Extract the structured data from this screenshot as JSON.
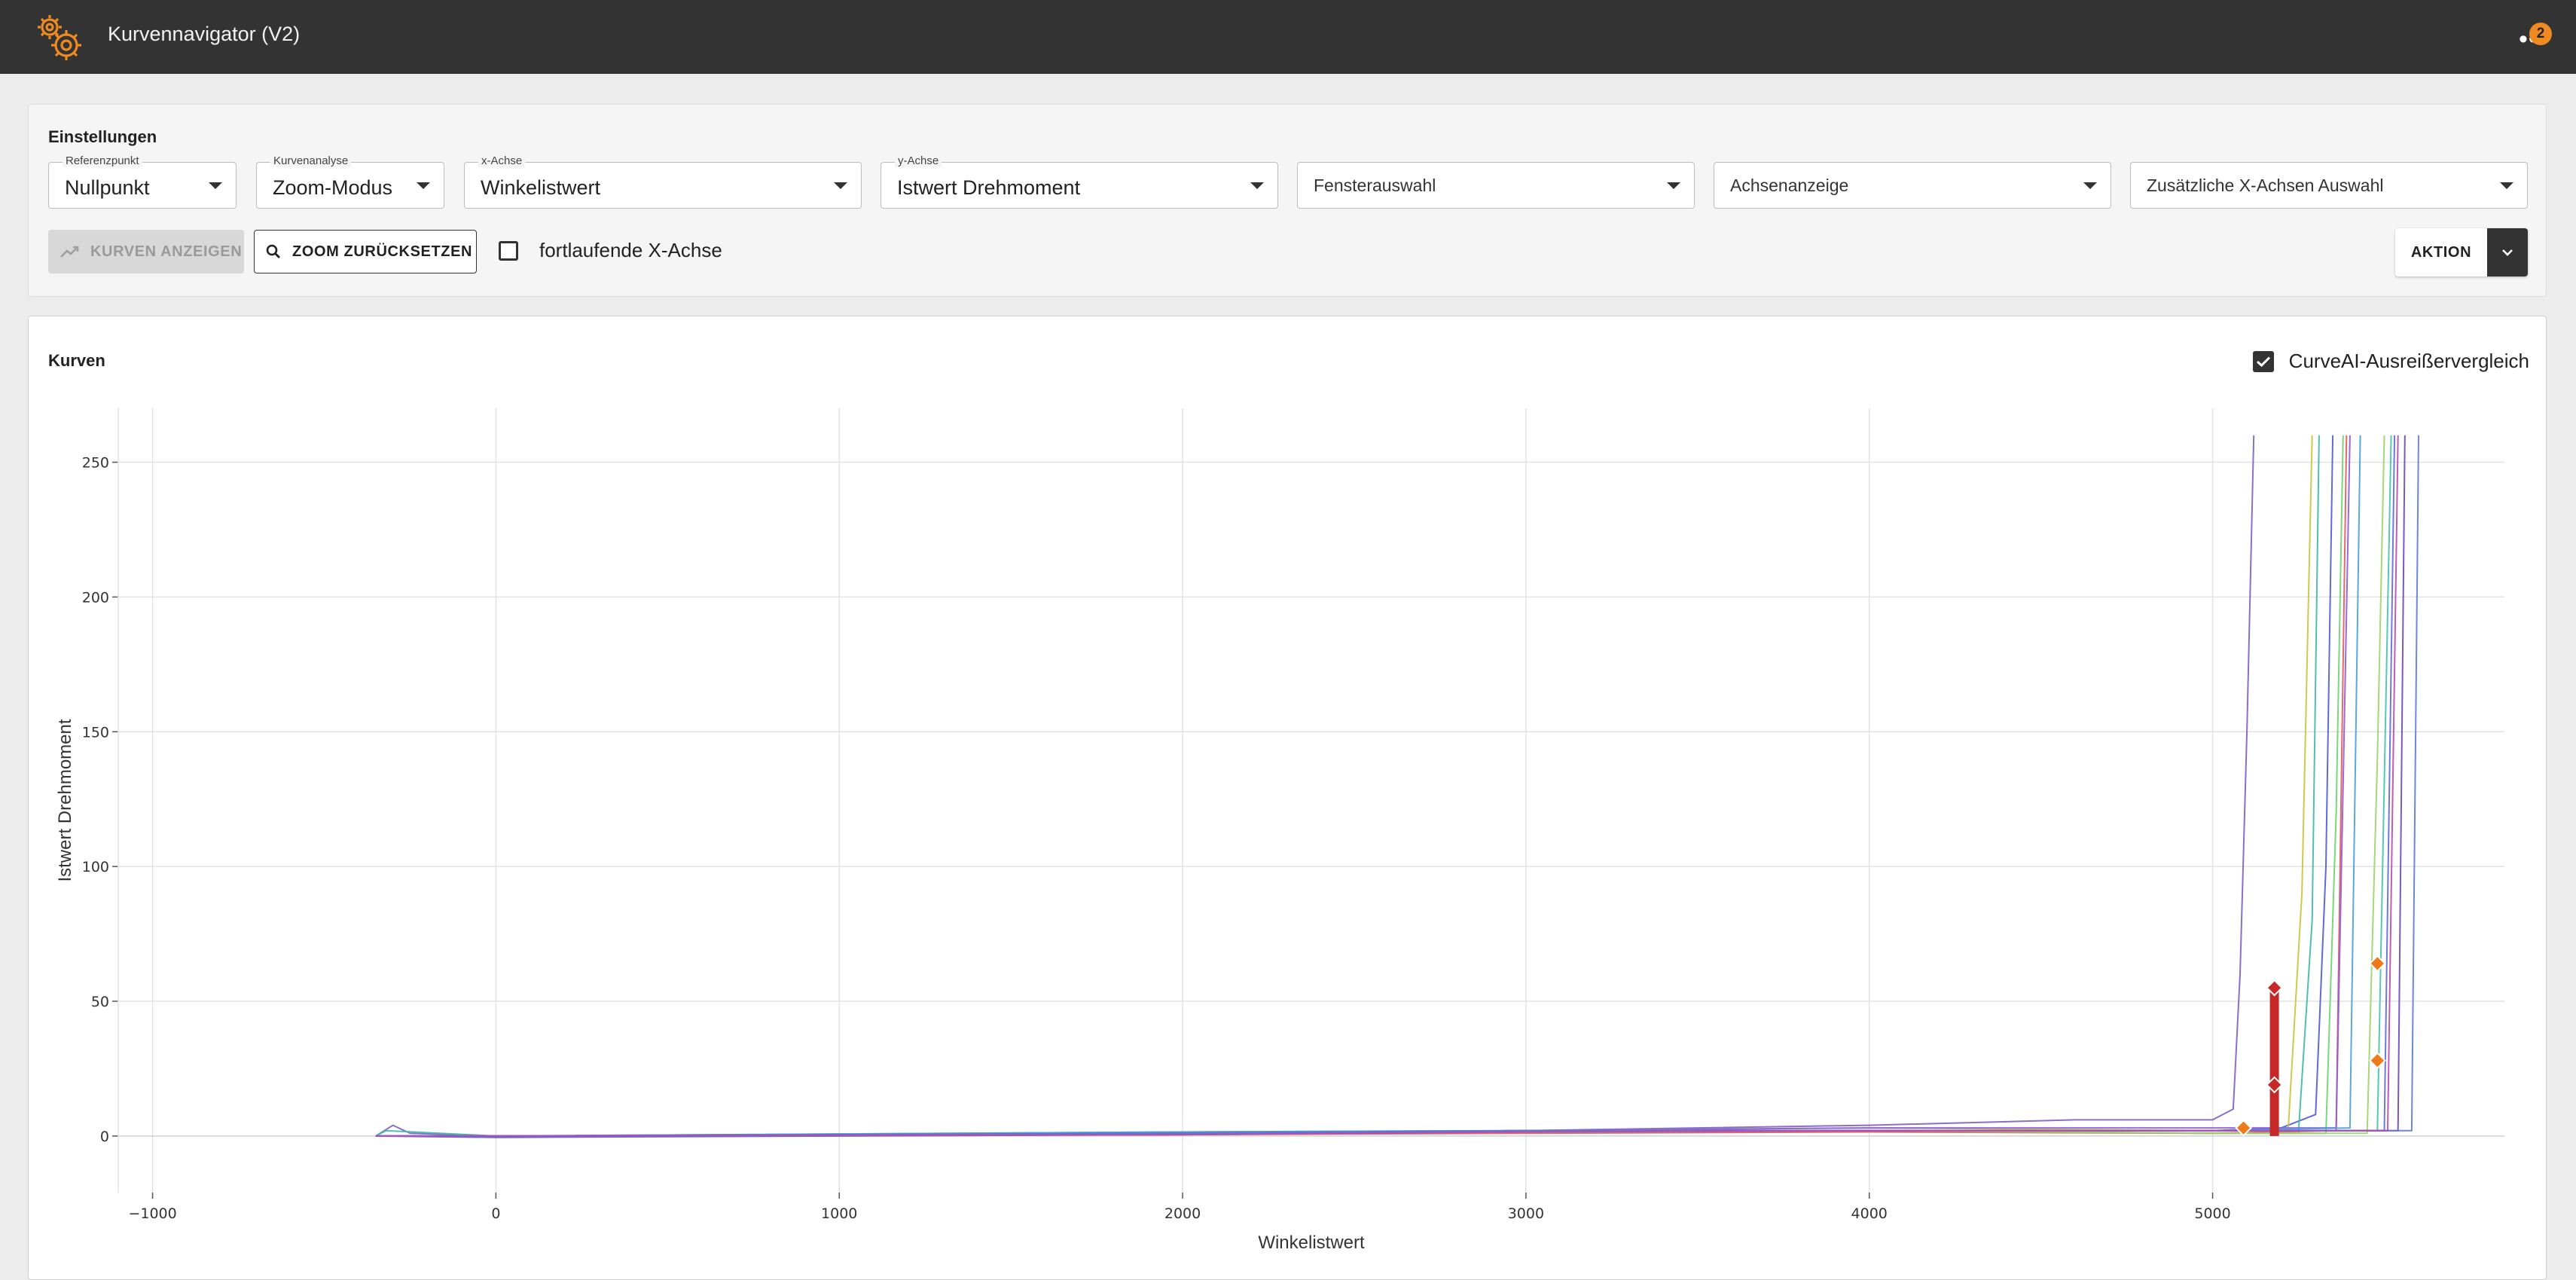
{
  "app": {
    "title": "Kurvennavigator (V2)",
    "notification_count": "2",
    "more_icon": "more-horizontal-icon",
    "logo_icon": "gears-icon",
    "accent": "#ef8a23"
  },
  "settings": {
    "title": "Einstellungen",
    "selects": [
      {
        "label": "Referenzpunkt",
        "value": "Nullpunkt"
      },
      {
        "label": "Kurvenanalyse",
        "value": "Zoom-Modus"
      },
      {
        "label": "x-Achse",
        "value": "Winkelistwert"
      },
      {
        "label": "y-Achse",
        "value": "Istwert Drehmoment"
      },
      {
        "label": "",
        "placeholder": "Fensterauswahl"
      },
      {
        "label": "",
        "placeholder": "Achsenanzeige"
      },
      {
        "label": "",
        "placeholder": "Zusätzliche X-Achsen Auswahl"
      }
    ],
    "show_curves_label": "KURVEN ANZEIGEN",
    "reset_zoom_label": "ZOOM ZURÜCKSETZEN",
    "continuous_x_label": "fortlaufende X-Achse",
    "continuous_x_checked": false,
    "action_label": "AKTION"
  },
  "curves": {
    "title": "Kurven",
    "ai_compare_label": "CurveAI-Ausreißervergleich",
    "ai_compare_checked": true
  },
  "chart_data": {
    "type": "line",
    "xlabel": "Winkelistwert",
    "ylabel": "Istwert Drehmoment",
    "xlim": [
      -1100,
      5850
    ],
    "ylim": [
      -21,
      270
    ],
    "xticks": [
      -1000,
      0,
      1000,
      2000,
      3000,
      4000,
      5000
    ],
    "xtick_labels": [
      "−1000",
      "0",
      "1000",
      "2000",
      "3000",
      "4000",
      "5000"
    ],
    "yticks": [
      0,
      50,
      100,
      150,
      200,
      250
    ],
    "grid": true,
    "series": [
      {
        "color": "#7b61c4",
        "values": [
          [
            -350,
            0
          ],
          [
            -300,
            4
          ],
          [
            -250,
            1
          ],
          [
            0,
            0
          ],
          [
            2000,
            1
          ],
          [
            3000,
            2
          ],
          [
            4000,
            4
          ],
          [
            4600,
            6
          ],
          [
            5000,
            6
          ],
          [
            5060,
            10
          ],
          [
            5080,
            60
          ],
          [
            5100,
            150
          ],
          [
            5120,
            260
          ]
        ]
      },
      {
        "color": "#4e5bd6",
        "values": [
          [
            -350,
            0
          ],
          [
            0,
            -0.5
          ],
          [
            2000,
            0.5
          ],
          [
            3000,
            1.5
          ],
          [
            4000,
            2
          ],
          [
            5000,
            2
          ],
          [
            5200,
            3
          ],
          [
            5300,
            8
          ],
          [
            5330,
            100
          ],
          [
            5350,
            260
          ]
        ]
      },
      {
        "color": "#3fb6a8",
        "values": [
          [
            -350,
            0
          ],
          [
            -320,
            2
          ],
          [
            0,
            0
          ],
          [
            2000,
            1.5
          ],
          [
            3000,
            2
          ],
          [
            4000,
            2
          ],
          [
            5000,
            1
          ],
          [
            5250,
            1
          ],
          [
            5290,
            80
          ],
          [
            5310,
            260
          ]
        ]
      },
      {
        "color": "#c9c43c",
        "values": [
          [
            -350,
            0
          ],
          [
            0,
            0
          ],
          [
            2000,
            1
          ],
          [
            3000,
            2
          ],
          [
            4000,
            3
          ],
          [
            5000,
            2
          ],
          [
            5220,
            2
          ],
          [
            5260,
            90
          ],
          [
            5290,
            260
          ]
        ]
      },
      {
        "color": "#6ad46a",
        "values": [
          [
            -350,
            0
          ],
          [
            0,
            0
          ],
          [
            2000,
            1
          ],
          [
            3000,
            2
          ],
          [
            4000,
            2
          ],
          [
            5000,
            1
          ],
          [
            5330,
            1
          ],
          [
            5360,
            120
          ],
          [
            5380,
            260
          ]
        ]
      },
      {
        "color": "#e05a5a",
        "values": [
          [
            -350,
            0
          ],
          [
            0,
            0
          ],
          [
            2000,
            0.5
          ],
          [
            3000,
            1
          ],
          [
            4000,
            1.5
          ],
          [
            5000,
            1
          ],
          [
            5360,
            2
          ],
          [
            5390,
            260
          ]
        ]
      },
      {
        "color": "#8d5bd8",
        "values": [
          [
            -350,
            0
          ],
          [
            0,
            0
          ],
          [
            2000,
            1
          ],
          [
            3000,
            2
          ],
          [
            4000,
            3
          ],
          [
            5000,
            3
          ],
          [
            5360,
            3
          ],
          [
            5380,
            130
          ],
          [
            5400,
            260
          ]
        ]
      },
      {
        "color": "#47a0d8",
        "values": [
          [
            -350,
            0
          ],
          [
            0,
            0
          ],
          [
            2000,
            1.5
          ],
          [
            3000,
            2
          ],
          [
            4000,
            2
          ],
          [
            5000,
            2
          ],
          [
            5400,
            3
          ],
          [
            5430,
            260
          ]
        ]
      },
      {
        "color": "#9ad46a",
        "values": [
          [
            -350,
            0
          ],
          [
            0,
            0
          ],
          [
            2000,
            1
          ],
          [
            3000,
            2
          ],
          [
            4000,
            2
          ],
          [
            5000,
            1
          ],
          [
            5450,
            1
          ],
          [
            5480,
            140
          ],
          [
            5500,
            260
          ]
        ]
      },
      {
        "color": "#45c2a8",
        "values": [
          [
            -350,
            0
          ],
          [
            0,
            0
          ],
          [
            2000,
            1
          ],
          [
            3000,
            1.5
          ],
          [
            4000,
            2
          ],
          [
            5000,
            2
          ],
          [
            5480,
            2
          ],
          [
            5520,
            260
          ]
        ]
      },
      {
        "color": "#5e6ad8",
        "values": [
          [
            -350,
            0
          ],
          [
            0,
            0
          ],
          [
            2000,
            1
          ],
          [
            3000,
            2
          ],
          [
            4000,
            2
          ],
          [
            5000,
            2
          ],
          [
            5500,
            2
          ],
          [
            5530,
            260
          ]
        ]
      },
      {
        "color": "#6b46b8",
        "values": [
          [
            -350,
            0
          ],
          [
            0,
            0
          ],
          [
            2000,
            1
          ],
          [
            3000,
            2
          ],
          [
            4000,
            2
          ],
          [
            5000,
            2
          ],
          [
            5540,
            2
          ],
          [
            5560,
            260
          ]
        ]
      },
      {
        "color": "#5e7ad8",
        "values": [
          [
            -350,
            0
          ],
          [
            0,
            0
          ],
          [
            2000,
            1
          ],
          [
            3000,
            2
          ],
          [
            4000,
            2
          ],
          [
            5000,
            2
          ],
          [
            5580,
            2
          ],
          [
            5600,
            260
          ]
        ]
      },
      {
        "color": "#b84ab0",
        "values": [
          [
            -350,
            0
          ],
          [
            0,
            0
          ],
          [
            2000,
            0.5
          ],
          [
            3000,
            1.5
          ],
          [
            4000,
            2
          ],
          [
            5000,
            2
          ],
          [
            5510,
            2
          ],
          [
            5540,
            260
          ]
        ]
      }
    ],
    "outlier_bar": {
      "x": 5180,
      "y0": 0,
      "y1": 55,
      "color": "#c62828"
    },
    "outlier_markers": [
      {
        "x": 5180,
        "y": 55,
        "color": "#c62828"
      },
      {
        "x": 5180,
        "y": 19,
        "color": "#c62828"
      },
      {
        "x": 5090,
        "y": 3,
        "color": "#ef7a1a"
      },
      {
        "x": 5480,
        "y": 64,
        "color": "#ef7a1a"
      },
      {
        "x": 5480,
        "y": 28,
        "color": "#ef7a1a"
      }
    ]
  }
}
